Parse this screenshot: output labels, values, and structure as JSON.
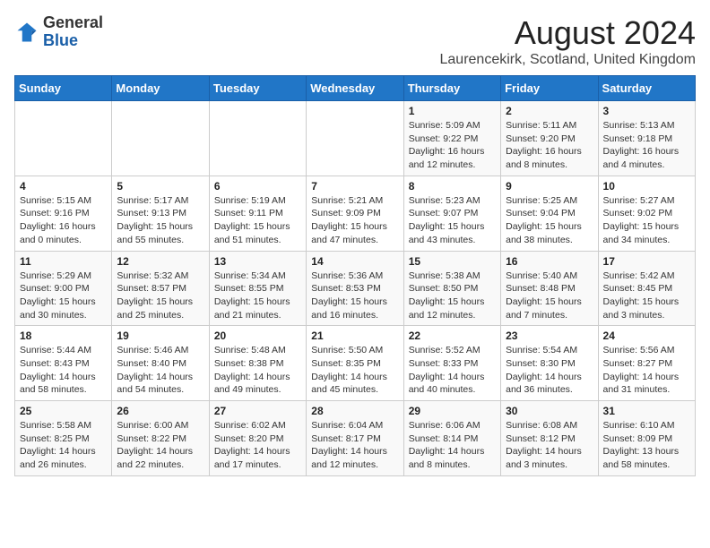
{
  "header": {
    "logo_general": "General",
    "logo_blue": "Blue",
    "month_title": "August 2024",
    "location": "Laurencekirk, Scotland, United Kingdom"
  },
  "weekdays": [
    "Sunday",
    "Monday",
    "Tuesday",
    "Wednesday",
    "Thursday",
    "Friday",
    "Saturday"
  ],
  "weeks": [
    [
      {
        "day": "",
        "info": ""
      },
      {
        "day": "",
        "info": ""
      },
      {
        "day": "",
        "info": ""
      },
      {
        "day": "",
        "info": ""
      },
      {
        "day": "1",
        "info": "Sunrise: 5:09 AM\nSunset: 9:22 PM\nDaylight: 16 hours\nand 12 minutes."
      },
      {
        "day": "2",
        "info": "Sunrise: 5:11 AM\nSunset: 9:20 PM\nDaylight: 16 hours\nand 8 minutes."
      },
      {
        "day": "3",
        "info": "Sunrise: 5:13 AM\nSunset: 9:18 PM\nDaylight: 16 hours\nand 4 minutes."
      }
    ],
    [
      {
        "day": "4",
        "info": "Sunrise: 5:15 AM\nSunset: 9:16 PM\nDaylight: 16 hours\nand 0 minutes."
      },
      {
        "day": "5",
        "info": "Sunrise: 5:17 AM\nSunset: 9:13 PM\nDaylight: 15 hours\nand 55 minutes."
      },
      {
        "day": "6",
        "info": "Sunrise: 5:19 AM\nSunset: 9:11 PM\nDaylight: 15 hours\nand 51 minutes."
      },
      {
        "day": "7",
        "info": "Sunrise: 5:21 AM\nSunset: 9:09 PM\nDaylight: 15 hours\nand 47 minutes."
      },
      {
        "day": "8",
        "info": "Sunrise: 5:23 AM\nSunset: 9:07 PM\nDaylight: 15 hours\nand 43 minutes."
      },
      {
        "day": "9",
        "info": "Sunrise: 5:25 AM\nSunset: 9:04 PM\nDaylight: 15 hours\nand 38 minutes."
      },
      {
        "day": "10",
        "info": "Sunrise: 5:27 AM\nSunset: 9:02 PM\nDaylight: 15 hours\nand 34 minutes."
      }
    ],
    [
      {
        "day": "11",
        "info": "Sunrise: 5:29 AM\nSunset: 9:00 PM\nDaylight: 15 hours\nand 30 minutes."
      },
      {
        "day": "12",
        "info": "Sunrise: 5:32 AM\nSunset: 8:57 PM\nDaylight: 15 hours\nand 25 minutes."
      },
      {
        "day": "13",
        "info": "Sunrise: 5:34 AM\nSunset: 8:55 PM\nDaylight: 15 hours\nand 21 minutes."
      },
      {
        "day": "14",
        "info": "Sunrise: 5:36 AM\nSunset: 8:53 PM\nDaylight: 15 hours\nand 16 minutes."
      },
      {
        "day": "15",
        "info": "Sunrise: 5:38 AM\nSunset: 8:50 PM\nDaylight: 15 hours\nand 12 minutes."
      },
      {
        "day": "16",
        "info": "Sunrise: 5:40 AM\nSunset: 8:48 PM\nDaylight: 15 hours\nand 7 minutes."
      },
      {
        "day": "17",
        "info": "Sunrise: 5:42 AM\nSunset: 8:45 PM\nDaylight: 15 hours\nand 3 minutes."
      }
    ],
    [
      {
        "day": "18",
        "info": "Sunrise: 5:44 AM\nSunset: 8:43 PM\nDaylight: 14 hours\nand 58 minutes."
      },
      {
        "day": "19",
        "info": "Sunrise: 5:46 AM\nSunset: 8:40 PM\nDaylight: 14 hours\nand 54 minutes."
      },
      {
        "day": "20",
        "info": "Sunrise: 5:48 AM\nSunset: 8:38 PM\nDaylight: 14 hours\nand 49 minutes."
      },
      {
        "day": "21",
        "info": "Sunrise: 5:50 AM\nSunset: 8:35 PM\nDaylight: 14 hours\nand 45 minutes."
      },
      {
        "day": "22",
        "info": "Sunrise: 5:52 AM\nSunset: 8:33 PM\nDaylight: 14 hours\nand 40 minutes."
      },
      {
        "day": "23",
        "info": "Sunrise: 5:54 AM\nSunset: 8:30 PM\nDaylight: 14 hours\nand 36 minutes."
      },
      {
        "day": "24",
        "info": "Sunrise: 5:56 AM\nSunset: 8:27 PM\nDaylight: 14 hours\nand 31 minutes."
      }
    ],
    [
      {
        "day": "25",
        "info": "Sunrise: 5:58 AM\nSunset: 8:25 PM\nDaylight: 14 hours\nand 26 minutes."
      },
      {
        "day": "26",
        "info": "Sunrise: 6:00 AM\nSunset: 8:22 PM\nDaylight: 14 hours\nand 22 minutes."
      },
      {
        "day": "27",
        "info": "Sunrise: 6:02 AM\nSunset: 8:20 PM\nDaylight: 14 hours\nand 17 minutes."
      },
      {
        "day": "28",
        "info": "Sunrise: 6:04 AM\nSunset: 8:17 PM\nDaylight: 14 hours\nand 12 minutes."
      },
      {
        "day": "29",
        "info": "Sunrise: 6:06 AM\nSunset: 8:14 PM\nDaylight: 14 hours\nand 8 minutes."
      },
      {
        "day": "30",
        "info": "Sunrise: 6:08 AM\nSunset: 8:12 PM\nDaylight: 14 hours\nand 3 minutes."
      },
      {
        "day": "31",
        "info": "Sunrise: 6:10 AM\nSunset: 8:09 PM\nDaylight: 13 hours\nand 58 minutes."
      }
    ]
  ]
}
